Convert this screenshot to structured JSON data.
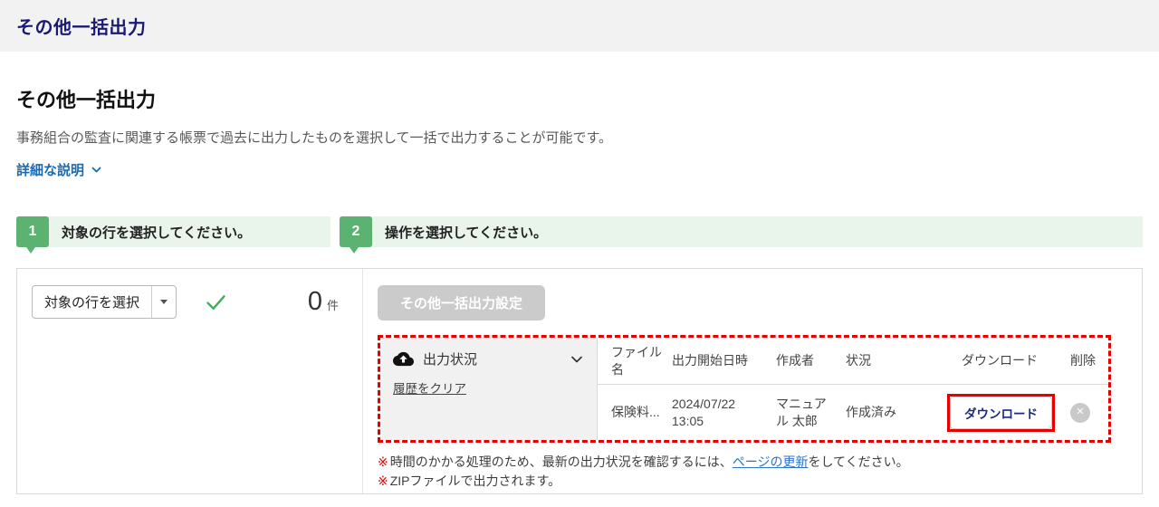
{
  "header": {
    "title": "その他一括出力"
  },
  "page": {
    "title": "その他一括出力",
    "description": "事務組合の監査に関連する帳票で過去に出力したものを選択して一括で出力することが可能です。",
    "detail_link": "詳細な説明"
  },
  "steps": [
    {
      "number": "1",
      "label": "対象の行を選択してください。"
    },
    {
      "number": "2",
      "label": "操作を選択してください。"
    }
  ],
  "selection": {
    "dropdown_label": "対象の行を選択",
    "count_value": "0",
    "count_unit": "件"
  },
  "actions": {
    "settings_button": "その他一括出力設定"
  },
  "output_status": {
    "title": "出力状況",
    "clear_history_link": "履歴をクリア",
    "table": {
      "headers": [
        "ファイル名",
        "出力開始日時",
        "作成者",
        "状況",
        "ダウンロード",
        "削除"
      ],
      "rows": [
        {
          "file_name": "保険料...",
          "start_datetime": "2024/07/22 13:05",
          "creator": "マニュアル 太郎",
          "status": "作成済み",
          "download_label": "ダウンロード"
        }
      ]
    }
  },
  "notes": [
    {
      "prefix": "※",
      "before_link": "時間のかかる処理のため、最新の出力状況を確認するには、",
      "link": "ページの更新",
      "after_link": "をしてください。"
    },
    {
      "prefix": "※",
      "text": "ZIPファイルで出力されます。"
    }
  ],
  "icons": {
    "chevron_down": "∨",
    "dropdown_caret": "▾",
    "check": "✓",
    "cloud_upload": "☁↑",
    "delete_x": "✕"
  },
  "colors": {
    "topbar_bg": "#f2f2f2",
    "title_navy": "#1a1a70",
    "link_blue": "#1b6bb4",
    "step_green": "#5cb270",
    "step_bar_bg": "#e9f4ea",
    "check_green": "#3fae5a",
    "annotation_red": "#e60000",
    "disabled_button_gray": "#cbcbcb",
    "download_text_navy": "#1a2a7e"
  }
}
